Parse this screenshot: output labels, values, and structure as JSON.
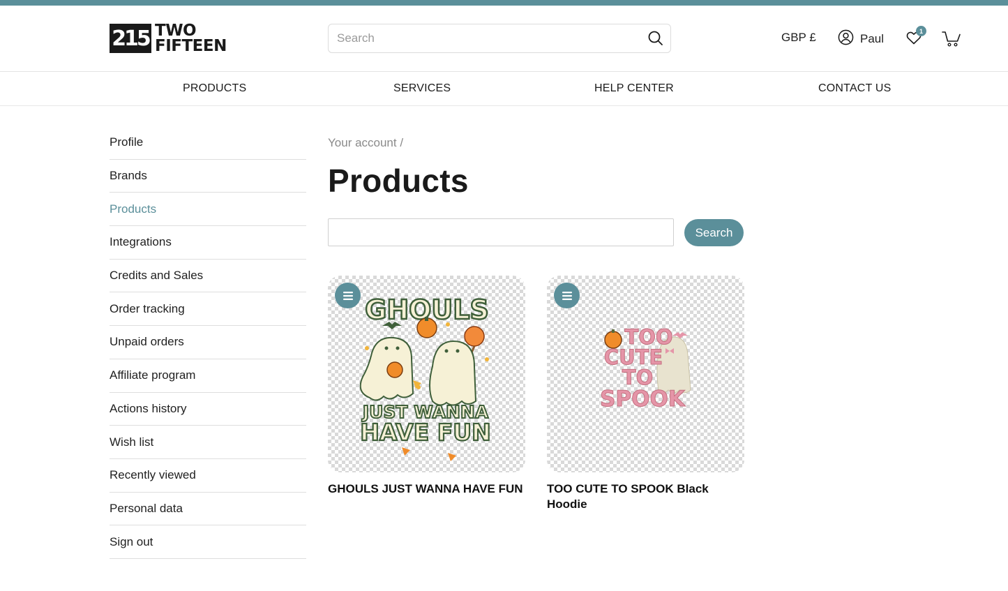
{
  "header": {
    "logo_mark": "215",
    "logo_line1": "TWO",
    "logo_line2": "FIFTEEN",
    "search_placeholder": "Search",
    "currency": "GBP £",
    "user_name": "Paul",
    "wishlist_count": "1"
  },
  "nav": {
    "items": [
      "PRODUCTS",
      "SERVICES",
      "HELP CENTER",
      "CONTACT US"
    ]
  },
  "sidebar": {
    "items": [
      {
        "label": "Profile"
      },
      {
        "label": "Brands"
      },
      {
        "label": "Products",
        "active": true
      },
      {
        "label": "Integrations"
      },
      {
        "label": "Credits and Sales"
      },
      {
        "label": "Order tracking"
      },
      {
        "label": "Unpaid orders"
      },
      {
        "label": "Affiliate program"
      },
      {
        "label": "Actions history"
      },
      {
        "label": "Wish list"
      },
      {
        "label": "Recently viewed"
      },
      {
        "label": "Personal data"
      },
      {
        "label": "Sign out"
      }
    ]
  },
  "main": {
    "breadcrumb": "Your account /",
    "title": "Products",
    "search_button": "Search",
    "products": [
      {
        "title": "GHOULS JUST WANNA HAVE FUN",
        "art_text_top": "GHOULS",
        "art_text_mid": "JUST WANNA",
        "art_text_bottom": "HAVE FUN"
      },
      {
        "title": "TOO CUTE TO SPOOK Black Hoodie",
        "art_lines": [
          "TOO",
          "CUTE",
          "TO",
          "SPOOK"
        ]
      }
    ]
  },
  "colors": {
    "accent": "#5b8f9a",
    "text": "#1a1a1a",
    "muted": "#8a8a8a"
  }
}
